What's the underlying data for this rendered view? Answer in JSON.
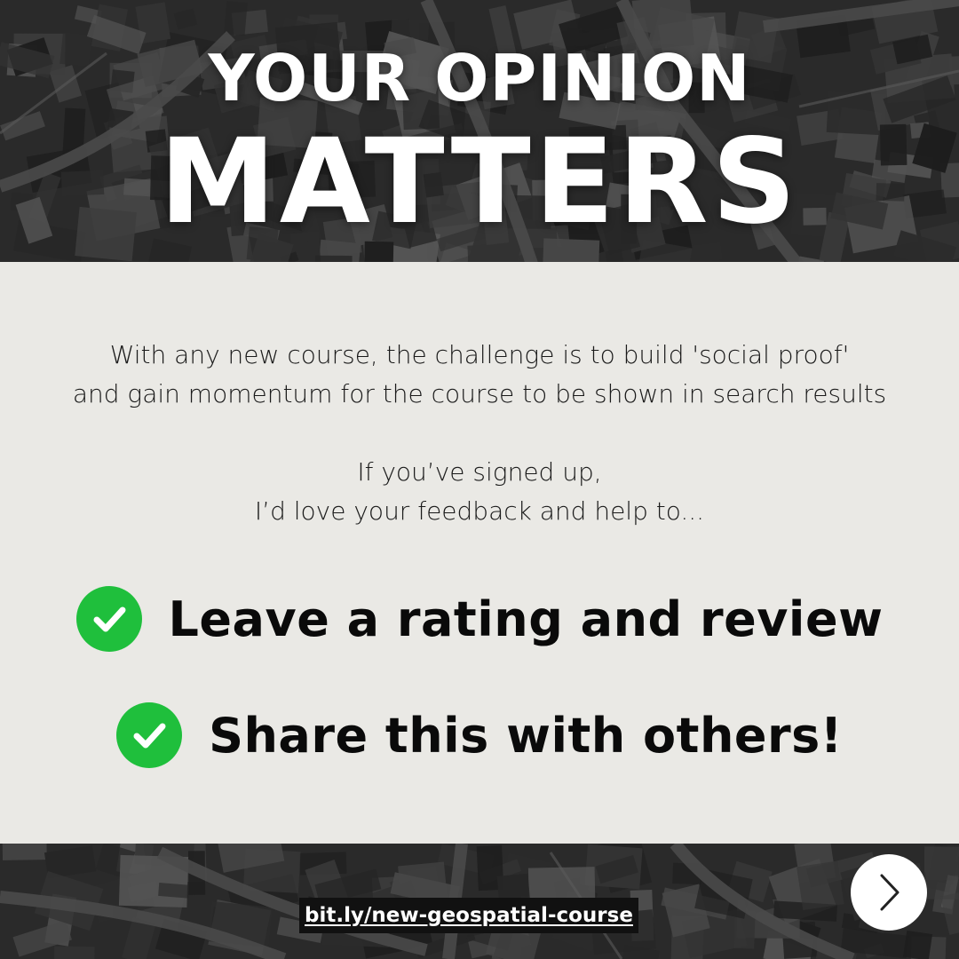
{
  "headline": {
    "line1": "YOUR OPINION",
    "line2": "MATTERS"
  },
  "intro": {
    "line1": "With any new course, the challenge is to build 'social proof'",
    "line2": "and gain momentum for the course to be shown in search results"
  },
  "request": {
    "line1": "If you’ve signed up,",
    "line2": "I’d love your feedback and help to..."
  },
  "actions": [
    {
      "label": "Leave a rating and review",
      "icon": "check-circle-icon"
    },
    {
      "label": "Share this with others!",
      "icon": "check-circle-icon"
    }
  ],
  "footer": {
    "url": "bit.ly/new-geospatial-course",
    "next_icon": "chevron-right-icon"
  },
  "colors": {
    "panel": "#eae9e5",
    "check": "#1fbf3c",
    "headline": "#ffffff",
    "text": "#1a1a1a"
  }
}
